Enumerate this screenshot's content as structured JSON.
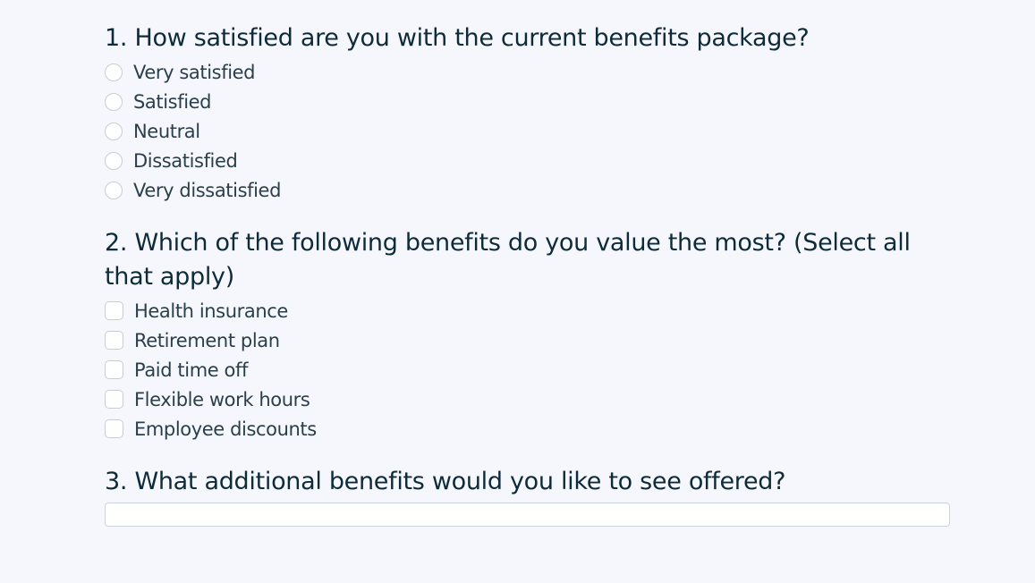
{
  "form": {
    "questions": [
      {
        "title": "1. How satisfied are you with the current benefits package?",
        "type": "radio",
        "options": [
          "Very satisfied",
          "Satisfied",
          "Neutral",
          "Dissatisfied",
          "Very dissatisfied"
        ]
      },
      {
        "title": "2. Which of the following benefits do you value the most? (Select all that apply)",
        "type": "checkbox",
        "options": [
          "Health insurance",
          "Retirement plan",
          "Paid time off",
          "Flexible work hours",
          "Employee discounts"
        ]
      },
      {
        "title": "3. What additional benefits would you like to see offered?",
        "type": "text",
        "value": "",
        "placeholder": ""
      }
    ]
  }
}
